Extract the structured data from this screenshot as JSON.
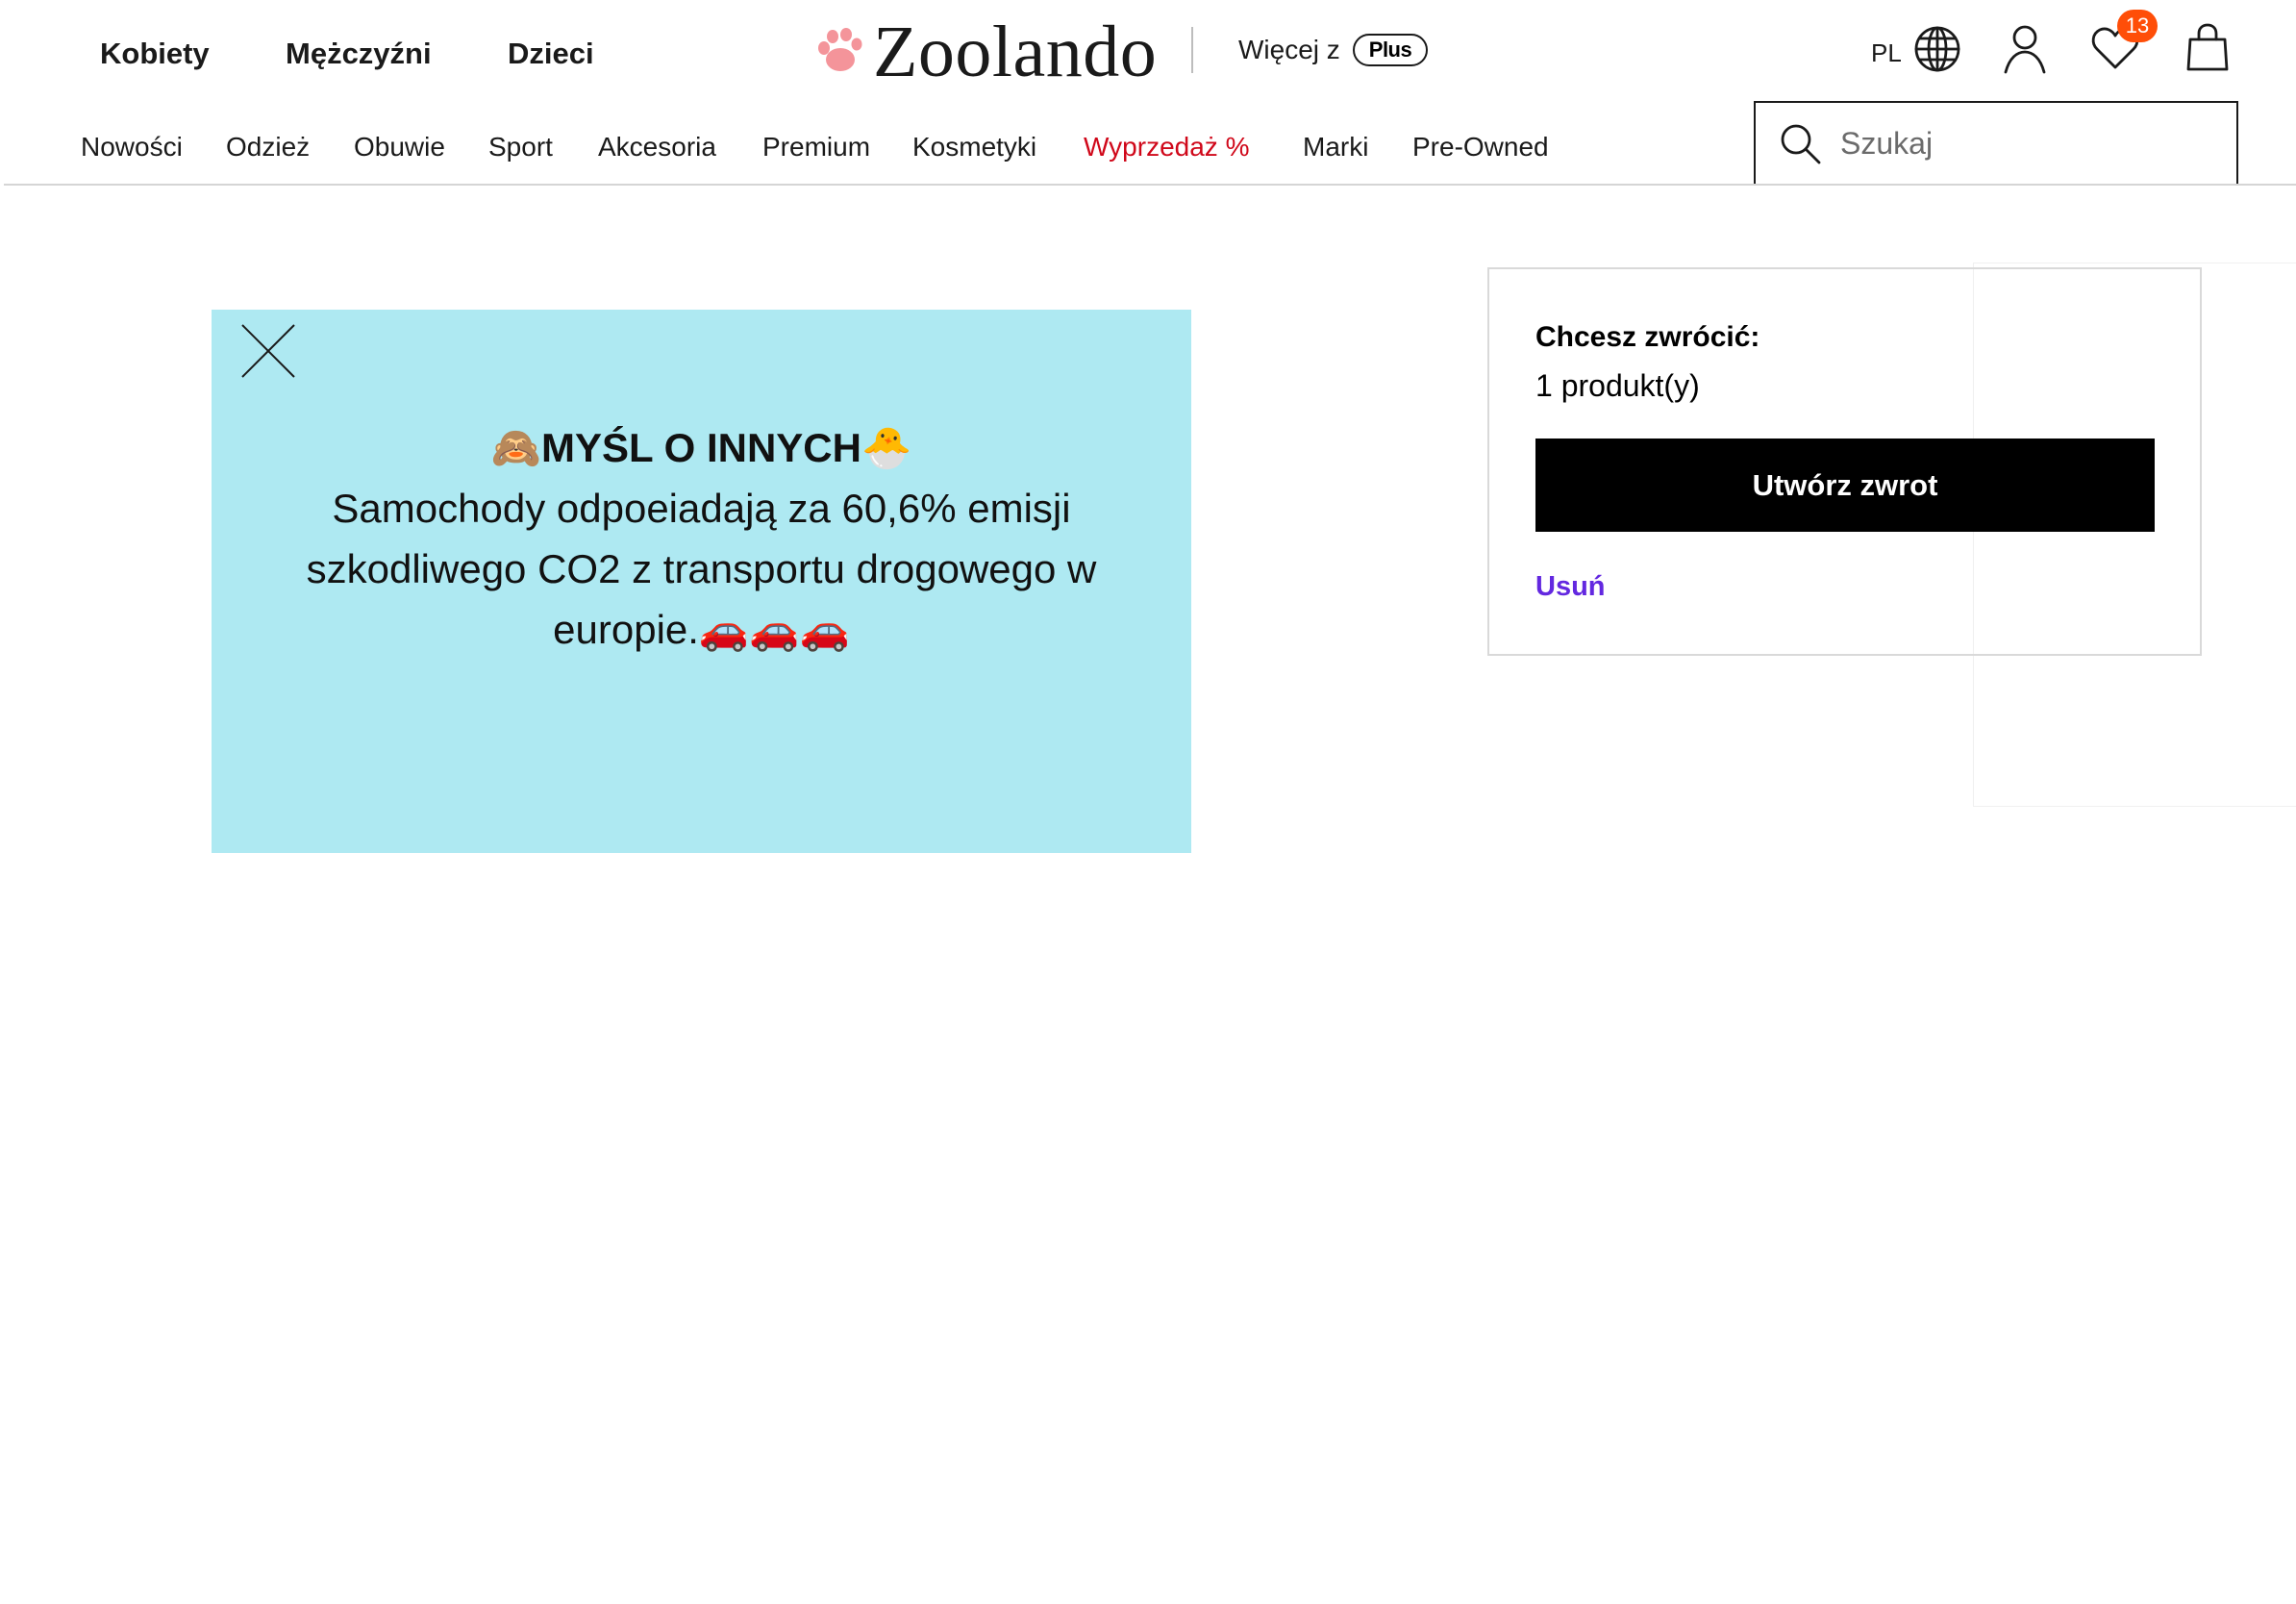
{
  "header": {
    "gender_nav": [
      "Kobiety",
      "Mężczyźni",
      "Dzieci"
    ],
    "logo_text": "Zoolando",
    "plus_prefix": "Więcej z",
    "plus_badge": "Plus",
    "language": "PL",
    "wishlist_count": "13",
    "icons": [
      "globe-icon",
      "user-icon",
      "heart-icon",
      "bag-icon",
      "search-icon"
    ]
  },
  "categories": [
    "Nowości",
    "Odzież",
    "Obuwie",
    "Sport",
    "Akcesoria",
    "Premium",
    "Kosmetyki",
    "Wyprzedaż %",
    "Marki",
    "Pre-Owned"
  ],
  "search": {
    "placeholder": "Szukaj",
    "value": ""
  },
  "promo": {
    "title": "🙈MYŚL O INNYCH🐣",
    "line1": "Samochody odpoeiadają za 60,6% emisji",
    "line2": "szkodliwego CO2 z transportu drogowego w",
    "line3": "europie.🚗🚗🚗",
    "background": "#aee9f2"
  },
  "return_card": {
    "label": "Chcesz zwrócić:",
    "count": "1 produkt(y)",
    "button": "Utwórz zwrot",
    "remove": "Usuń"
  },
  "colors": {
    "accent_purple": "#6328e0",
    "sale_red": "#d0081a",
    "badge_orange": "#ff4e08",
    "logo_pink": "#f4949a"
  }
}
